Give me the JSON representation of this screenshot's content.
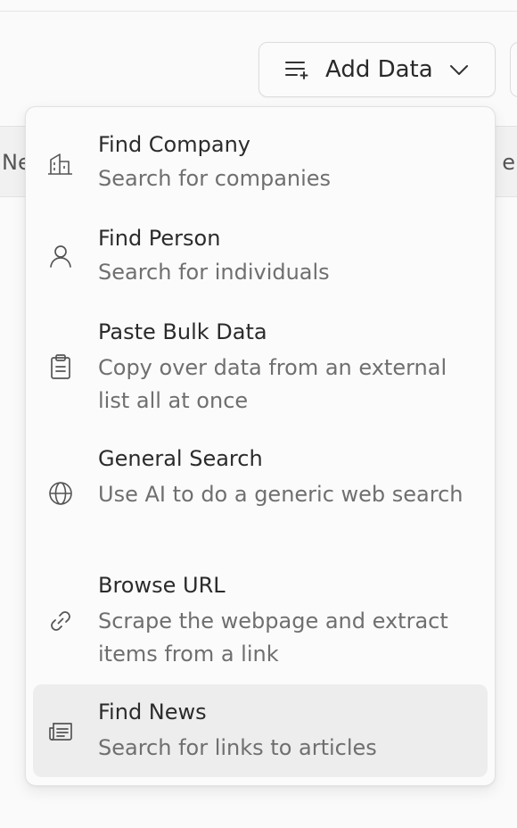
{
  "header": {
    "add_data_label": "Add Data",
    "col_left_fragment": "Ne",
    "col_right_fragment": "e"
  },
  "menu": {
    "items": [
      {
        "title": "Find Company",
        "desc": "Search for companies",
        "icon": "building-icon"
      },
      {
        "title": "Find Person",
        "desc": "Search for individuals",
        "icon": "user-icon"
      },
      {
        "title": "Paste Bulk Data",
        "desc": "Copy over data from an external list all at once",
        "icon": "clipboard-icon"
      },
      {
        "title": "General Search",
        "desc": "Use AI to do a generic web search",
        "icon": "globe-icon"
      },
      {
        "title": "Browse URL",
        "desc": "Scrape the webpage and extract items from a link",
        "icon": "link-icon"
      },
      {
        "title": "Find News",
        "desc": "Search for links to articles",
        "icon": "newspaper-icon"
      }
    ],
    "active_index": 5
  },
  "colors": {
    "background": "#fafafa",
    "menu_bg": "#fbfbfb",
    "active_bg": "#ededed",
    "title_text": "#2b2b2b",
    "desc_text": "#6f6f6f"
  }
}
